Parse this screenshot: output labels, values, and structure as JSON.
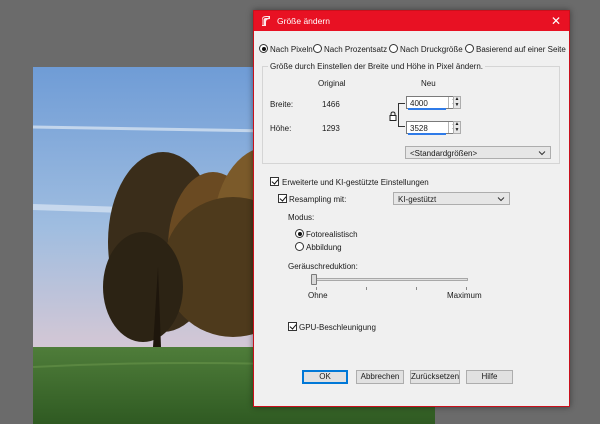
{
  "dialog": {
    "title": "Größe ändern",
    "close_glyph": "✕",
    "icon": "paint-brush-icon",
    "accent": "#e81123"
  },
  "mode_tabs": [
    {
      "label": "Nach Pixeln",
      "checked": true
    },
    {
      "label": "Nach Prozentsatz",
      "checked": false
    },
    {
      "label": "Nach Druckgröße",
      "checked": false
    },
    {
      "label": "Basierend auf einer Seite",
      "checked": false
    }
  ],
  "size_group": {
    "label": "Größe durch Einstellen der Breite und Höhe in Pixel ändern.",
    "col_original": "Original",
    "col_new": "Neu",
    "width_label": "Breite:",
    "height_label": "Höhe:",
    "width_original": "1466",
    "height_original": "1293",
    "width_new": "4000",
    "height_new": "3528",
    "aspect_lock": "lock-icon",
    "preset": "<Standardgrößen>"
  },
  "advanced": {
    "label": "Erweiterte und KI-gestützte Einstellungen",
    "checked": true,
    "resampling_label": "Resampling mit:",
    "resampling_checked": true,
    "resampling_value": "KI-gestützt",
    "modus_label": "Modus:",
    "modes": [
      {
        "label": "Fotorealistisch",
        "checked": true
      },
      {
        "label": "Abbildung",
        "checked": false
      }
    ],
    "noise_label": "Geräuschreduktion:",
    "noise_min": "Ohne",
    "noise_max": "Maximum",
    "noise_value": 0,
    "gpu_label": "GPU-Beschleunigung",
    "gpu_checked": true
  },
  "buttons": {
    "ok": "OK",
    "cancel": "Abbrechen",
    "reset": "Zurücksetzen",
    "help": "Hilfe"
  }
}
